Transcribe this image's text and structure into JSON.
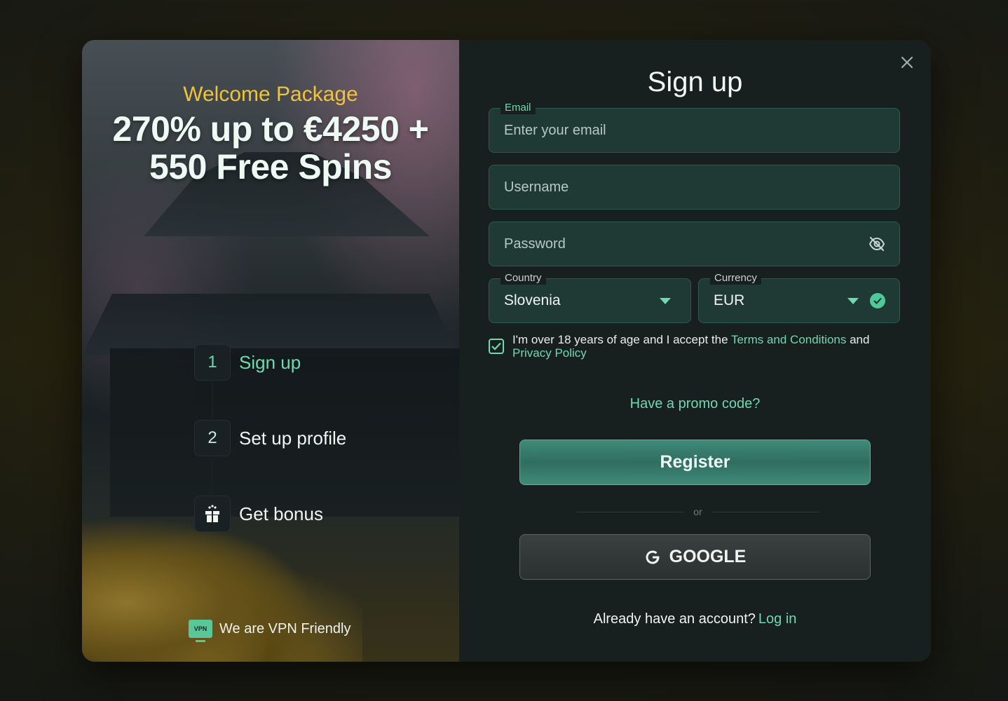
{
  "promo": {
    "kicker": "Welcome Package",
    "headline": "270% up to €4250 + 550 Free Spins",
    "steps": [
      {
        "num": "1",
        "label": "Sign up",
        "active": true
      },
      {
        "num": "2",
        "label": "Set up profile",
        "active": false
      },
      {
        "icon": "gift-icon",
        "label": "Get bonus",
        "active": false
      }
    ],
    "vpn_badge": "VPN",
    "vpn_text": "We are VPN Friendly"
  },
  "form": {
    "title": "Sign up",
    "close_icon": "close-icon",
    "email": {
      "label": "Email",
      "placeholder": "Enter your email"
    },
    "username": {
      "placeholder": "Username"
    },
    "password": {
      "placeholder": "Password",
      "icon": "eye-off-icon"
    },
    "country": {
      "label": "Country",
      "value": "Slovenia"
    },
    "currency": {
      "label": "Currency",
      "value": "EUR"
    },
    "terms": {
      "text_before": "I'm over 18 years of age and I accept the ",
      "terms_link": "Terms and Conditions",
      "text_mid": " and ",
      "privacy_link": "Privacy Policy",
      "checked": true
    },
    "promo_link": "Have a promo code?",
    "register_label": "Register",
    "divider_text": "or",
    "google_label": "GOOGLE",
    "login_prompt": "Already have an account?",
    "login_link": "Log in"
  },
  "colors": {
    "accent": "#6fd9b0",
    "kicker": "#f0c33c",
    "field_bg": "#1f3a35",
    "panel_bg": "#171f1f"
  }
}
